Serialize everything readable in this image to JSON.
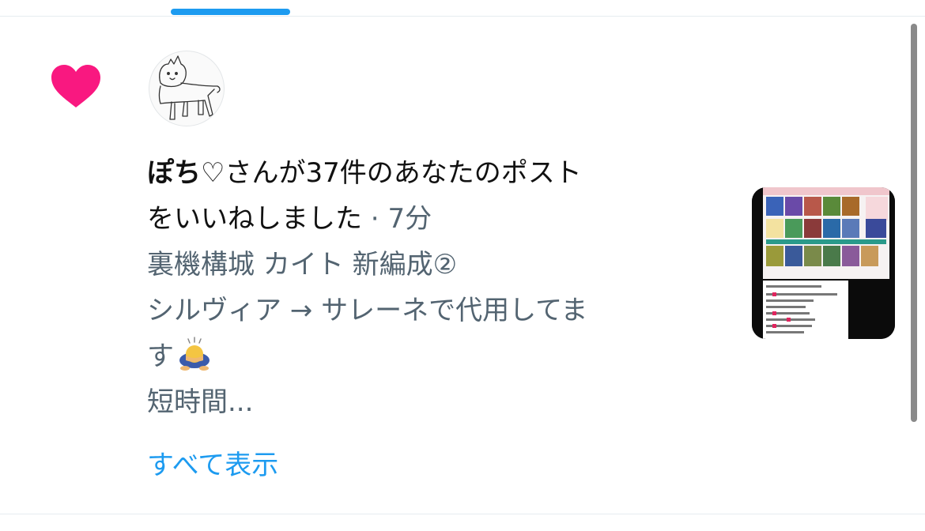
{
  "notification": {
    "user_name": "ぽち♡",
    "action_line1": "さんが37件のあなたのポスト",
    "action_line2": "をいいねしました",
    "separator": " · ",
    "time_ago": "7分"
  },
  "tweet": {
    "line1": "裏機構城 カイト 新編成②",
    "line2": "シルヴィア → サレーネで代用してま",
    "line3": "す",
    "line4": "短時間..."
  },
  "show_all_label": "すべて表示",
  "colors": {
    "heart": "#f91880",
    "link": "#1d9bf0",
    "secondary_text": "#536471"
  },
  "icons": {
    "like": "heart-icon",
    "emoji": "person-bowing-icon"
  }
}
